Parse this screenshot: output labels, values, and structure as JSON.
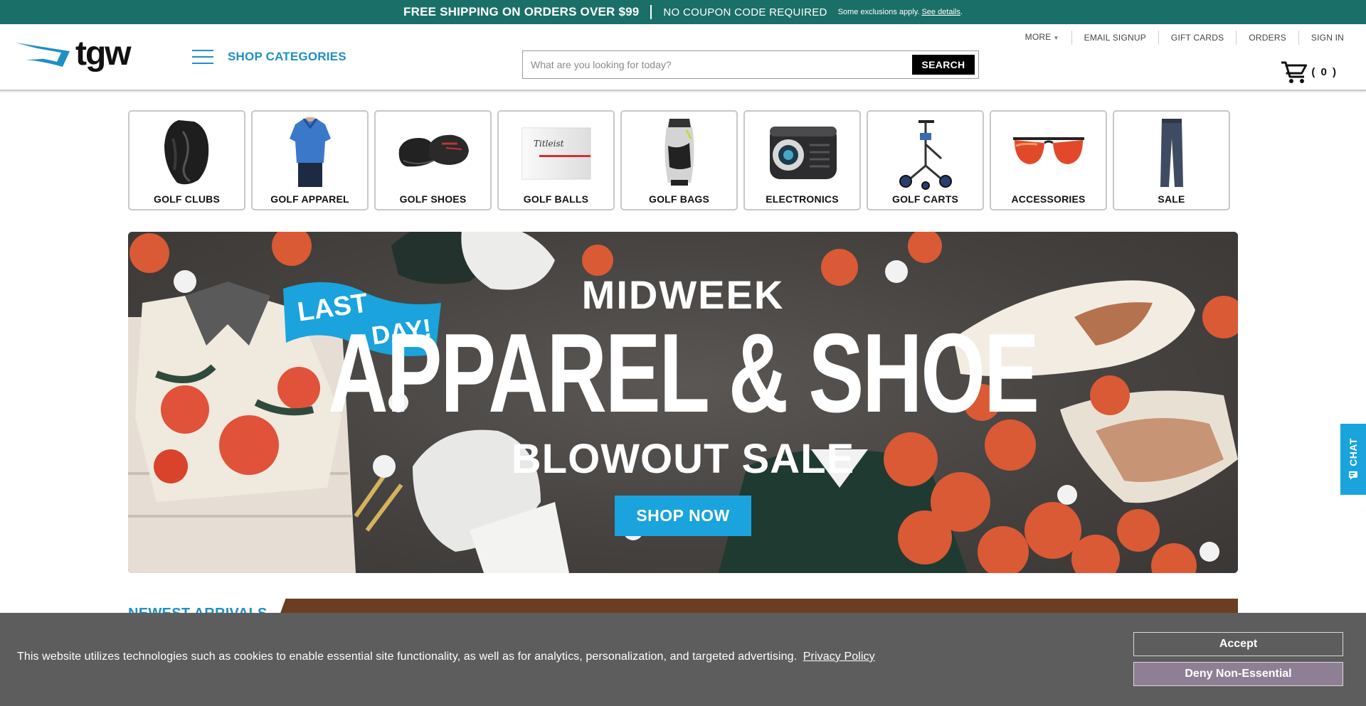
{
  "promo": {
    "main": "FREE SHIPPING ON ORDERS OVER $99",
    "sub": "NO COUPON CODE REQUIRED",
    "small": "Some exclusions apply.",
    "link": "See details",
    "link_suffix": "."
  },
  "header": {
    "logo_text": "tgw",
    "shop_categories": "SHOP CATEGORIES",
    "search_placeholder": "What are you looking for today?",
    "search_button": "SEARCH",
    "util": {
      "more": "MORE",
      "email": "EMAIL SIGNUP",
      "gift": "GIFT CARDS",
      "orders": "ORDERS",
      "signin": "SIGN IN"
    },
    "cart_count": "( 0 )"
  },
  "categories": [
    {
      "label": "GOLF CLUBS",
      "icon": "golf-club-icon"
    },
    {
      "label": "GOLF APPAREL",
      "icon": "polo-shirt-icon"
    },
    {
      "label": "GOLF SHOES",
      "icon": "golf-shoe-icon"
    },
    {
      "label": "GOLF BALLS",
      "icon": "golf-ball-box-icon"
    },
    {
      "label": "GOLF BAGS",
      "icon": "golf-bag-icon"
    },
    {
      "label": "ELECTRONICS",
      "icon": "rangefinder-icon"
    },
    {
      "label": "GOLF CARTS",
      "icon": "push-cart-icon"
    },
    {
      "label": "ACCESSORIES",
      "icon": "sunglasses-icon"
    },
    {
      "label": "SALE",
      "icon": "pants-icon"
    }
  ],
  "banner": {
    "flag_line1": "LAST",
    "flag_line2": "DAY!",
    "line1": "MIDWEEK",
    "headline": "APPAREL & SHOE",
    "line3": "BLOWOUT SALE",
    "cta": "SHOP NOW"
  },
  "newest": {
    "title": "NEWEST ARRIVALS"
  },
  "chat": {
    "label": "CHAT"
  },
  "cookie": {
    "text": "This website utilizes technologies such as cookies to enable essential site functionality, as well as for analytics, personalization, and targeted advertising.",
    "policy_link": "Privacy Policy",
    "accept": "Accept",
    "deny": "Deny Non-Essential"
  },
  "colors": {
    "promo_bg": "#1b6f69",
    "accent_blue": "#1f8fc5",
    "cta_blue": "#1aa3dd",
    "cookie_bg": "#5d5d5d",
    "deny_bg": "#8f7f94"
  }
}
